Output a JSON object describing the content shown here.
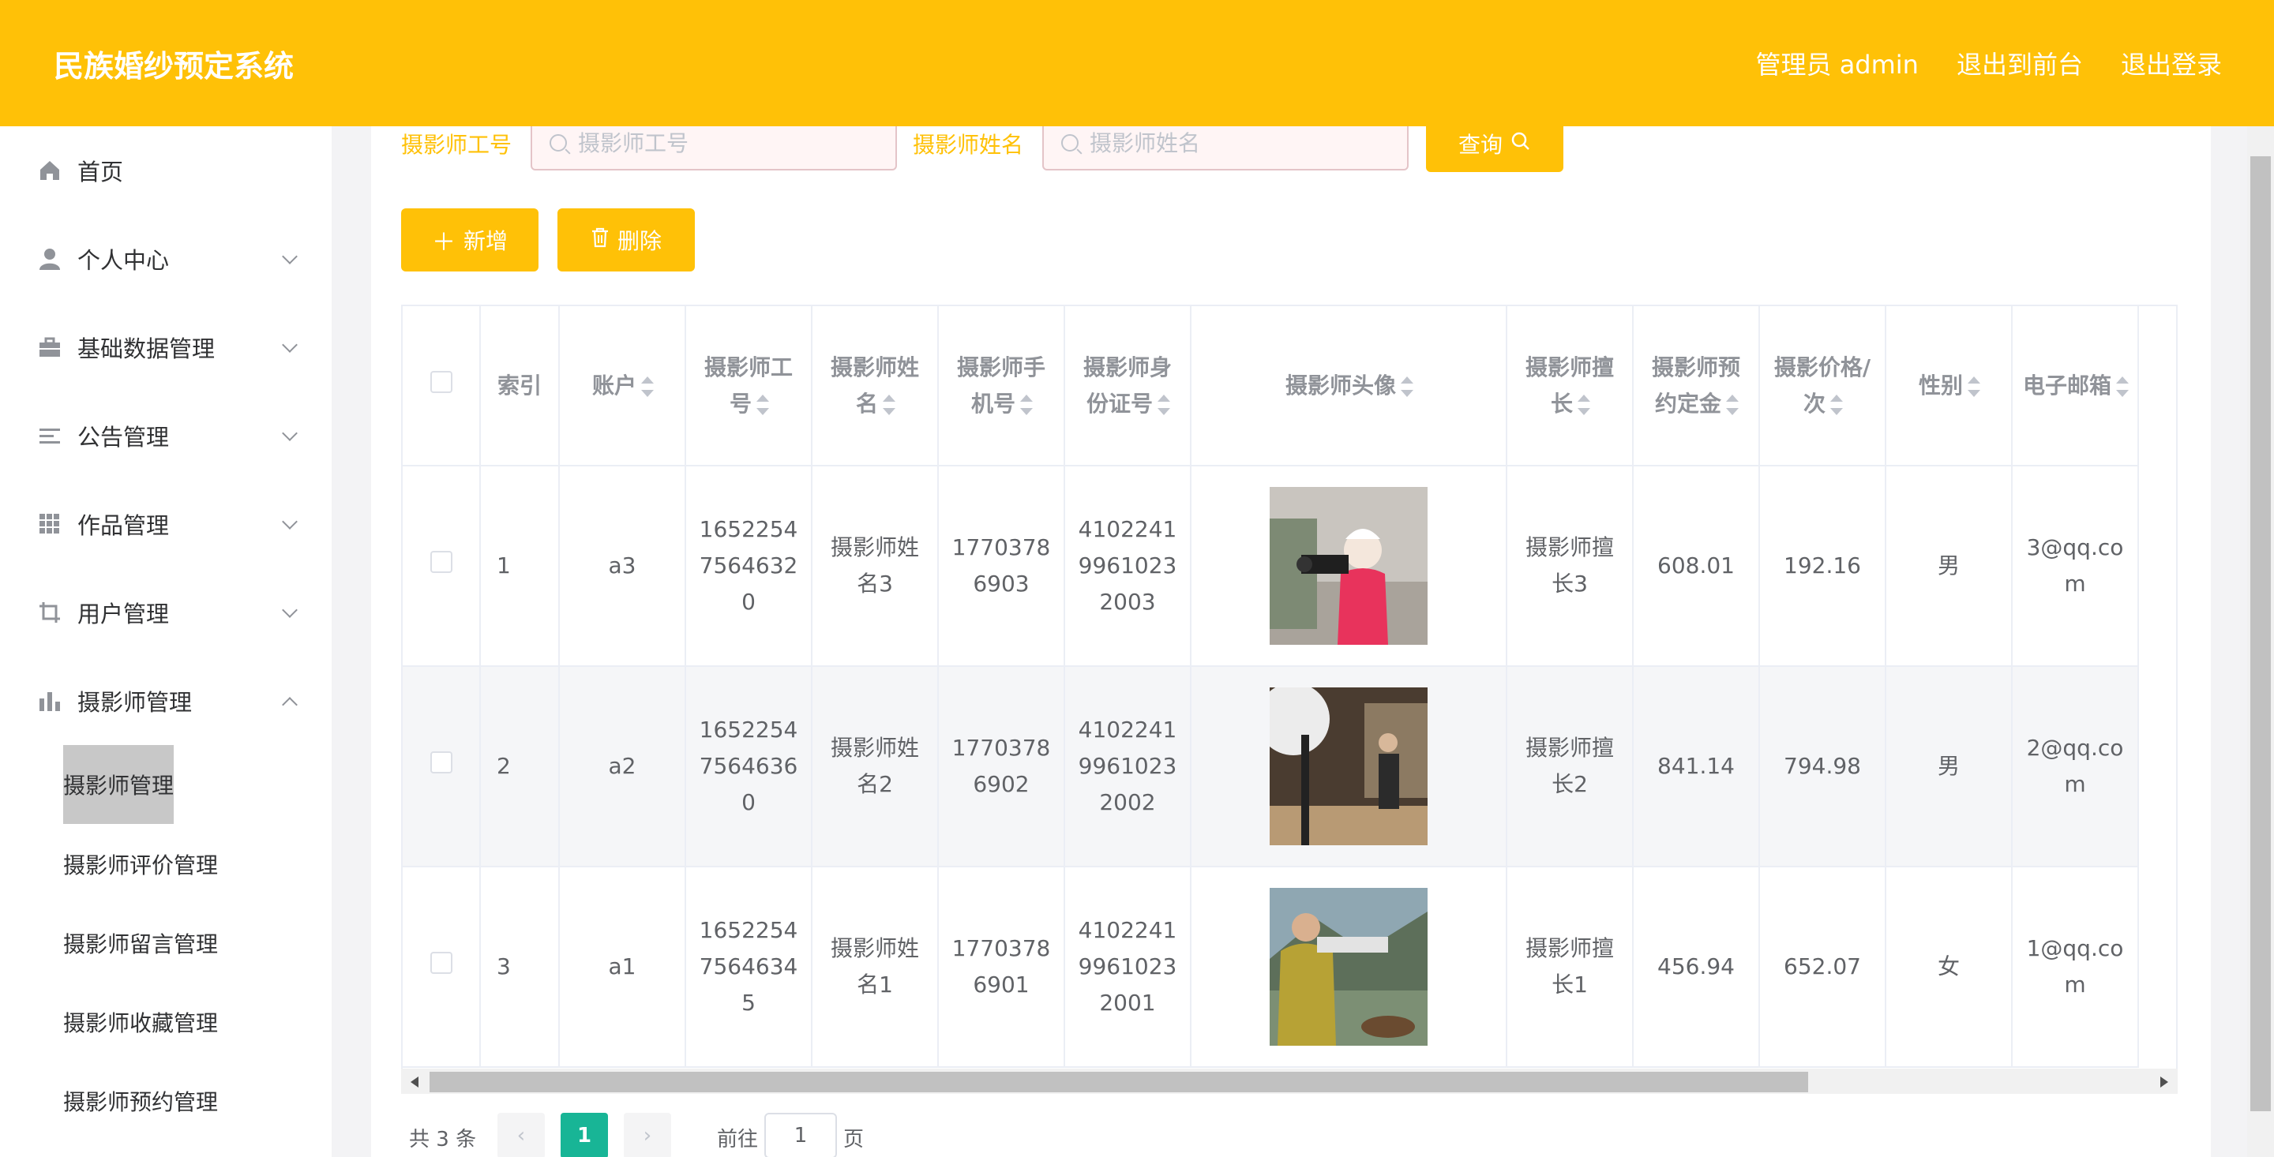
{
  "header": {
    "title": "民族婚纱预定系统",
    "admin": "管理员 admin",
    "to_front": "退出到前台",
    "logout": "退出登录"
  },
  "sidebar": {
    "items": [
      {
        "label": "首页",
        "icon": "home-icon"
      },
      {
        "label": "个人中心",
        "icon": "user-icon"
      },
      {
        "label": "基础数据管理",
        "icon": "briefcase-icon"
      },
      {
        "label": "公告管理",
        "icon": "list-icon"
      },
      {
        "label": "作品管理",
        "icon": "grid-icon"
      },
      {
        "label": "用户管理",
        "icon": "crop-icon"
      },
      {
        "label": "摄影师管理",
        "icon": "bar-chart-icon"
      }
    ],
    "sub_items": [
      "摄影师管理",
      "摄影师评价管理",
      "摄影师留言管理",
      "摄影师收藏管理",
      "摄影师预约管理"
    ]
  },
  "search": {
    "id_label": "摄影师工号",
    "id_placeholder": "摄影师工号",
    "name_label": "摄影师姓名",
    "name_placeholder": "摄影师姓名",
    "query_button": "查询"
  },
  "actions": {
    "add": "新增",
    "delete": "删除"
  },
  "table": {
    "columns": [
      "索引",
      "账户",
      "摄影师工号",
      "摄影师姓名",
      "摄影师手机号",
      "摄影师身份证号",
      "摄影师头像",
      "摄影师擅长",
      "摄影师预约定金",
      "摄影价格/次",
      "性别",
      "电子邮箱"
    ],
    "rows": [
      {
        "index": "1",
        "account": "a3",
        "id": "16522547564632 0",
        "name": "摄影师姓名3",
        "phone": "17703786903",
        "idcard": "410224199610232003",
        "specialty": "摄影师擅长3",
        "deposit": "608.01",
        "price": "192.16",
        "gender": "男",
        "email": "3@qq.com"
      },
      {
        "index": "2",
        "account": "a2",
        "id": "16522547564636 0",
        "name": "摄影师姓名2",
        "phone": "17703786902",
        "idcard": "410224199610232002",
        "specialty": "摄影师擅长2",
        "deposit": "841.14",
        "price": "794.98",
        "gender": "男",
        "email": "2@qq.com"
      },
      {
        "index": "3",
        "account": "a1",
        "id": "16522547564634 5",
        "name": "摄影师姓名1",
        "phone": "17703786901",
        "idcard": "410224199610232001",
        "specialty": "摄影师擅长1",
        "deposit": "456.94",
        "price": "652.07",
        "gender": "女",
        "email": "1@qq.com"
      }
    ]
  },
  "pager": {
    "total": "共 3 条",
    "current": "1",
    "goto_prefix": "前往",
    "goto_value": "1",
    "goto_suffix": "页"
  },
  "colors": {
    "accent": "#ffc107",
    "pager_active": "#18b596"
  }
}
